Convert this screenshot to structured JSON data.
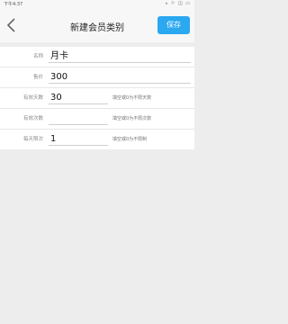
{
  "status": {
    "time": "下午4:37",
    "icons": "⁎ ⚐ ◫ ▭"
  },
  "navbar": {
    "title": "新建会员类别",
    "save_label": "保存"
  },
  "form": {
    "rows": [
      {
        "label": "名称",
        "value": "月卡",
        "hint": ""
      },
      {
        "label": "售价",
        "value": "300",
        "hint": ""
      },
      {
        "label": "有效天数",
        "value": "30",
        "hint": "填空或0为不限天数"
      },
      {
        "label": "有效次数",
        "value": "",
        "hint": "填空或0为不限次数"
      },
      {
        "label": "每天限次",
        "value": "1",
        "hint": "填空或0为不限制"
      }
    ]
  }
}
